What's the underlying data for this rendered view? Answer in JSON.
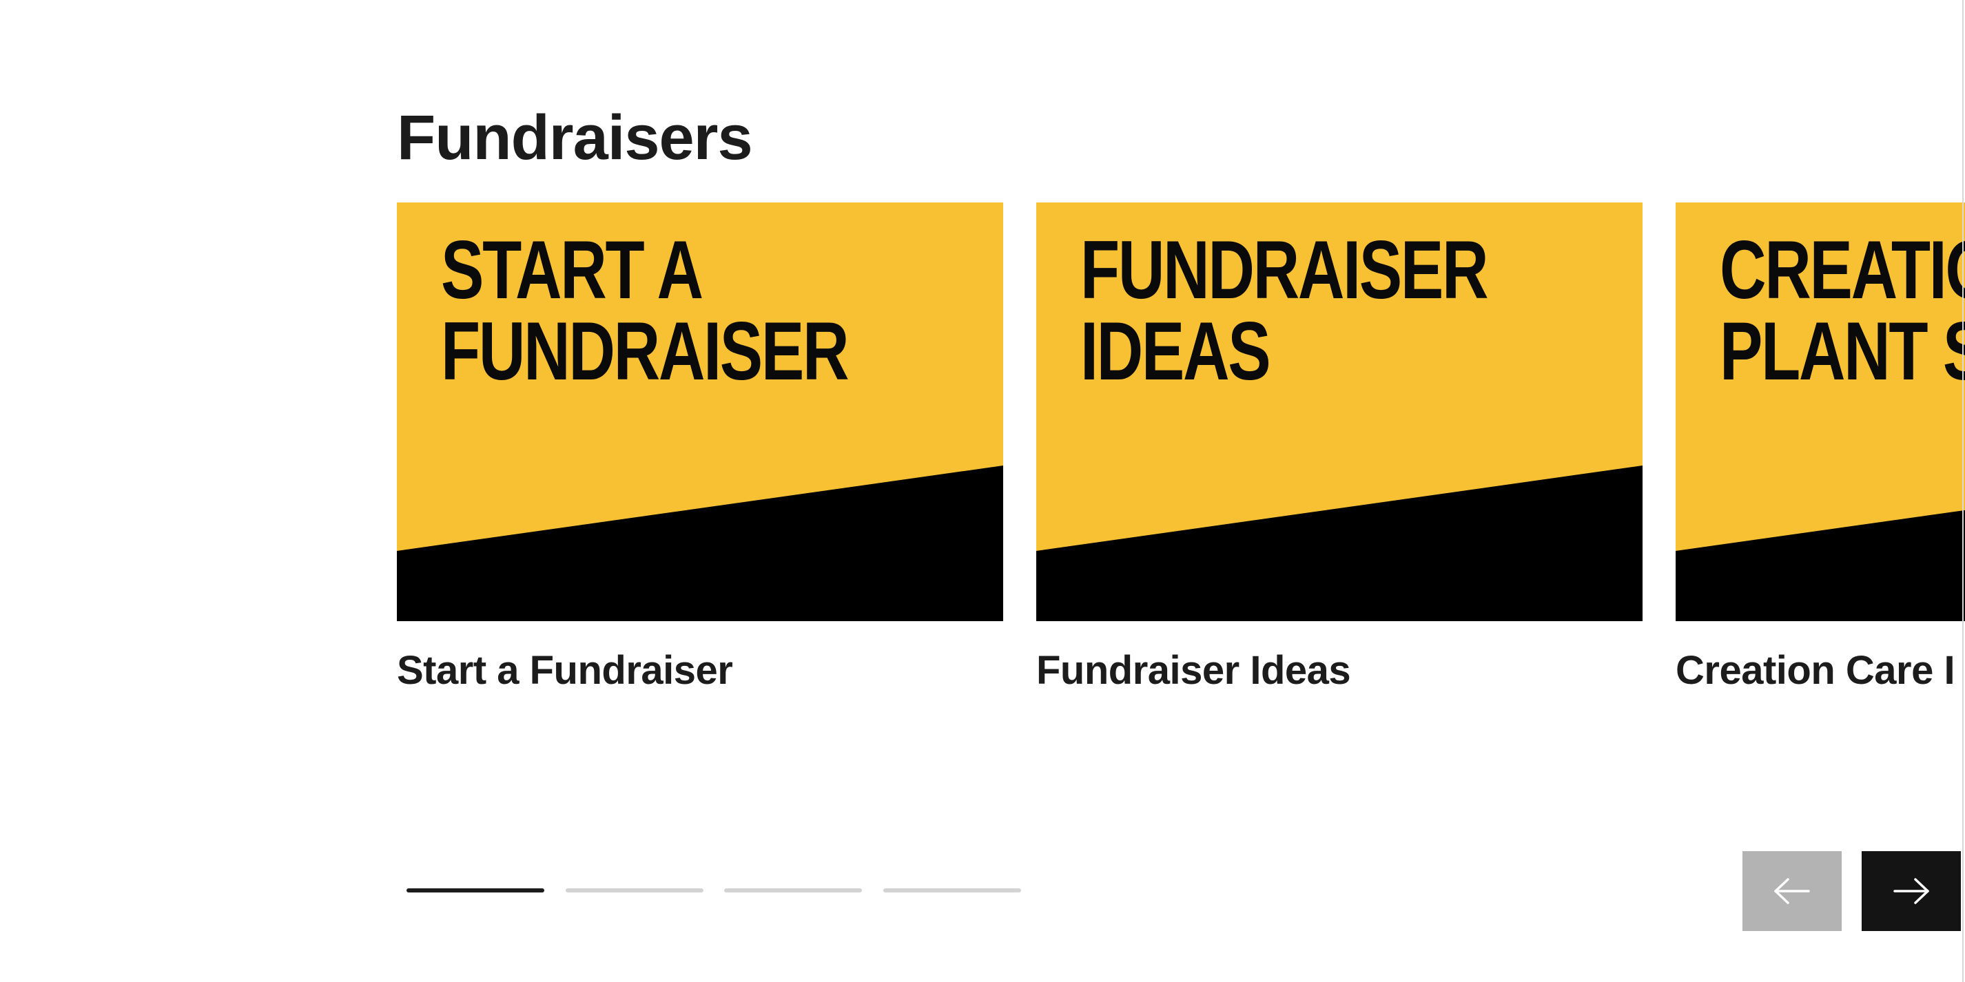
{
  "section": {
    "title": "Fundraisers"
  },
  "cards": [
    {
      "image_text": "START A\nFUNDRAISER",
      "title": "Start a Fundraiser"
    },
    {
      "image_text": "FUNDRAISER\nIDEAS",
      "title": "Fundraiser Ideas"
    },
    {
      "image_text": "CREATIO\nPLANT S",
      "title": "Creation Care I"
    }
  ],
  "pagination": {
    "total": 4,
    "active_index": 0
  },
  "navigation": {
    "prev_icon": "arrow-left-icon",
    "next_icon": "arrow-right-icon",
    "prev_disabled": true
  },
  "colors": {
    "image_yellow": "#f8c033",
    "image_black": "#000000",
    "text_dark": "#1c1c1c",
    "indicator_active": "#1c1c1c",
    "indicator_inactive": "#d3d3d3",
    "prev_button_bg": "#b3b3b3",
    "next_button_bg": "#141414"
  }
}
